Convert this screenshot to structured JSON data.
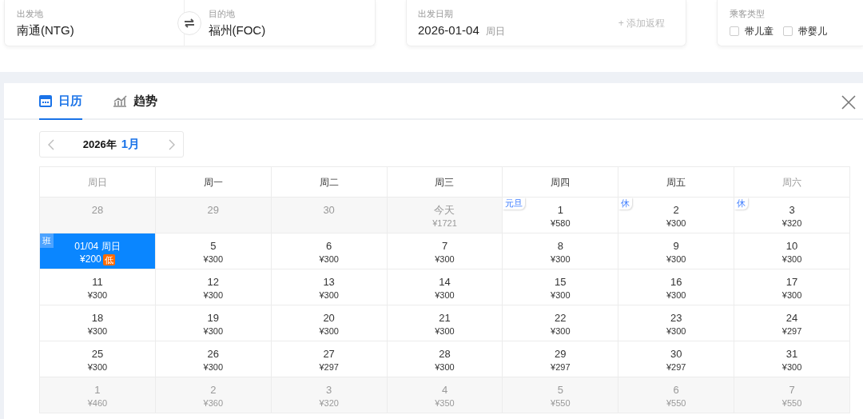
{
  "search": {
    "origin": {
      "label": "出发地",
      "value": "南通(NTG)"
    },
    "destination": {
      "label": "目的地",
      "value": "福州(FOC)"
    },
    "date": {
      "label": "出发日期",
      "value": "2026-01-04",
      "weekday": "周日",
      "add_return": "+ 添加返程"
    },
    "passengers": {
      "label": "乘客类型",
      "options": [
        {
          "label": "带儿童",
          "checked": false
        },
        {
          "label": "带婴儿",
          "checked": false
        }
      ]
    }
  },
  "tabs": [
    {
      "label": "日历",
      "kind": "calendar",
      "selected": true
    },
    {
      "label": "趋势",
      "kind": "trend",
      "selected": false
    }
  ],
  "month_nav": {
    "year": "2026年",
    "month": "1月"
  },
  "weekdays": [
    {
      "label": "周日",
      "muted": true
    },
    {
      "label": "周一",
      "muted": false
    },
    {
      "label": "周二",
      "muted": false
    },
    {
      "label": "周三",
      "muted": false
    },
    {
      "label": "周四",
      "muted": false
    },
    {
      "label": "周五",
      "muted": false
    },
    {
      "label": "周六",
      "muted": true
    }
  ],
  "weeks": [
    [
      {
        "day": "28",
        "kind": "disabled"
      },
      {
        "day": "29",
        "kind": "disabled"
      },
      {
        "day": "30",
        "kind": "disabled"
      },
      {
        "day": "今天",
        "price": "¥1721",
        "kind": "disabled"
      },
      {
        "day": "1",
        "price": "¥580",
        "kind": "normal",
        "tag": "元旦"
      },
      {
        "day": "2",
        "price": "¥300",
        "kind": "normal",
        "tag": "休"
      },
      {
        "day": "3",
        "price": "¥320",
        "kind": "normal",
        "tag": "休"
      }
    ],
    [
      {
        "day": "01/04 周日",
        "price": "¥200",
        "kind": "selected",
        "tag": "班",
        "badge": "低"
      },
      {
        "day": "5",
        "price": "¥300",
        "kind": "normal"
      },
      {
        "day": "6",
        "price": "¥300",
        "kind": "normal"
      },
      {
        "day": "7",
        "price": "¥300",
        "kind": "normal"
      },
      {
        "day": "8",
        "price": "¥300",
        "kind": "normal"
      },
      {
        "day": "9",
        "price": "¥300",
        "kind": "normal"
      },
      {
        "day": "10",
        "price": "¥300",
        "kind": "normal"
      }
    ],
    [
      {
        "day": "11",
        "price": "¥300",
        "kind": "normal"
      },
      {
        "day": "12",
        "price": "¥300",
        "kind": "normal"
      },
      {
        "day": "13",
        "price": "¥300",
        "kind": "normal"
      },
      {
        "day": "14",
        "price": "¥300",
        "kind": "normal"
      },
      {
        "day": "15",
        "price": "¥300",
        "kind": "normal"
      },
      {
        "day": "16",
        "price": "¥300",
        "kind": "normal"
      },
      {
        "day": "17",
        "price": "¥300",
        "kind": "normal"
      }
    ],
    [
      {
        "day": "18",
        "price": "¥300",
        "kind": "normal"
      },
      {
        "day": "19",
        "price": "¥300",
        "kind": "normal"
      },
      {
        "day": "20",
        "price": "¥300",
        "kind": "normal"
      },
      {
        "day": "21",
        "price": "¥300",
        "kind": "normal"
      },
      {
        "day": "22",
        "price": "¥300",
        "kind": "normal"
      },
      {
        "day": "23",
        "price": "¥300",
        "kind": "normal"
      },
      {
        "day": "24",
        "price": "¥297",
        "kind": "normal"
      }
    ],
    [
      {
        "day": "25",
        "price": "¥300",
        "kind": "normal"
      },
      {
        "day": "26",
        "price": "¥300",
        "kind": "normal"
      },
      {
        "day": "27",
        "price": "¥297",
        "kind": "normal"
      },
      {
        "day": "28",
        "price": "¥300",
        "kind": "normal"
      },
      {
        "day": "29",
        "price": "¥297",
        "kind": "normal"
      },
      {
        "day": "30",
        "price": "¥297",
        "kind": "normal"
      },
      {
        "day": "31",
        "price": "¥300",
        "kind": "normal"
      }
    ],
    [
      {
        "day": "1",
        "price": "¥460",
        "kind": "disabled"
      },
      {
        "day": "2",
        "price": "¥360",
        "kind": "disabled"
      },
      {
        "day": "3",
        "price": "¥320",
        "kind": "disabled"
      },
      {
        "day": "4",
        "price": "¥350",
        "kind": "disabled"
      },
      {
        "day": "5",
        "price": "¥550",
        "kind": "disabled"
      },
      {
        "day": "6",
        "price": "¥550",
        "kind": "disabled"
      },
      {
        "day": "7",
        "price": "¥550",
        "kind": "disabled"
      }
    ]
  ]
}
